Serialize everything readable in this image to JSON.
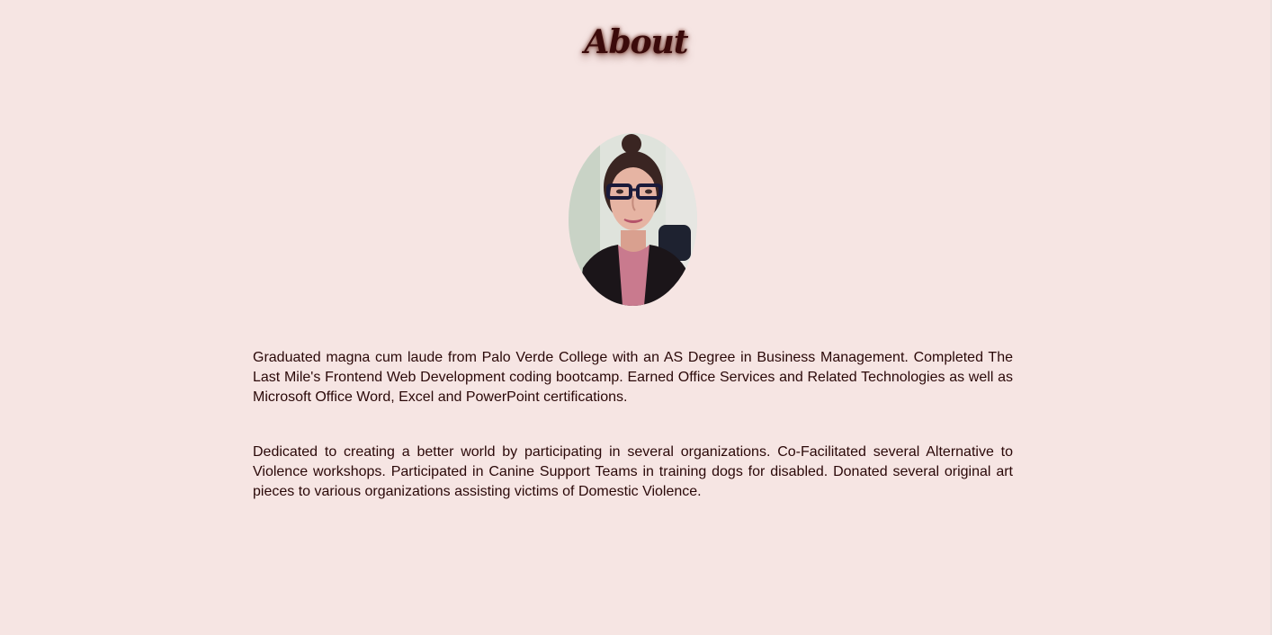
{
  "about": {
    "title": "About",
    "photo_alt": "Portrait photo",
    "paragraphs": [
      "Graduated magna cum laude from Palo Verde College with an AS Degree in Business Management. Completed The Last Mile's Frontend Web Development coding bootcamp. Earned Office Services and Related Technologies as well as Microsoft Office Word, Excel and PowerPoint certifications.",
      "Dedicated to creating a better world by participating in several organizations. Co-Facilitated several Alternative to Violence workshops. Participated in Canine Support Teams in training dogs for disabled. Donated several original art pieces to various organizations assisting victims of Domestic Violence."
    ]
  },
  "colors": {
    "background": "#f6e5e3",
    "title": "#3b0a0a",
    "body_text": "#2a0808"
  }
}
